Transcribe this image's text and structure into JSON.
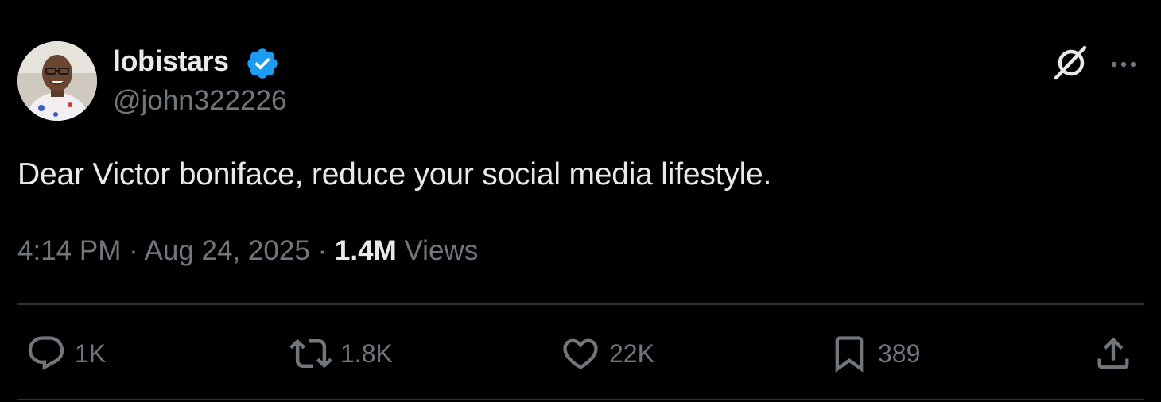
{
  "user": {
    "display_name": "lobistars",
    "handle": "@john322226",
    "verified": true,
    "avatar_icon": "profile-photo"
  },
  "tweet": {
    "text": "Dear Victor boniface, reduce your social media lifestyle.",
    "time": "4:14 PM",
    "separator": "·",
    "date": "Aug 24, 2025",
    "views_count": "1.4M",
    "views_label": "Views"
  },
  "actions": {
    "reply": {
      "icon": "reply-icon",
      "count": "1K"
    },
    "repost": {
      "icon": "repost-icon",
      "count": "1.8K"
    },
    "like": {
      "icon": "heart-icon",
      "count": "22K"
    },
    "bookmark": {
      "icon": "bookmark-icon",
      "count": "389"
    },
    "share": {
      "icon": "share-icon"
    }
  },
  "colors": {
    "background": "#000000",
    "text_primary": "#e7e9ea",
    "text_secondary": "#71767b",
    "verified_blue": "#1d9bf0",
    "divider": "#2f3336"
  }
}
